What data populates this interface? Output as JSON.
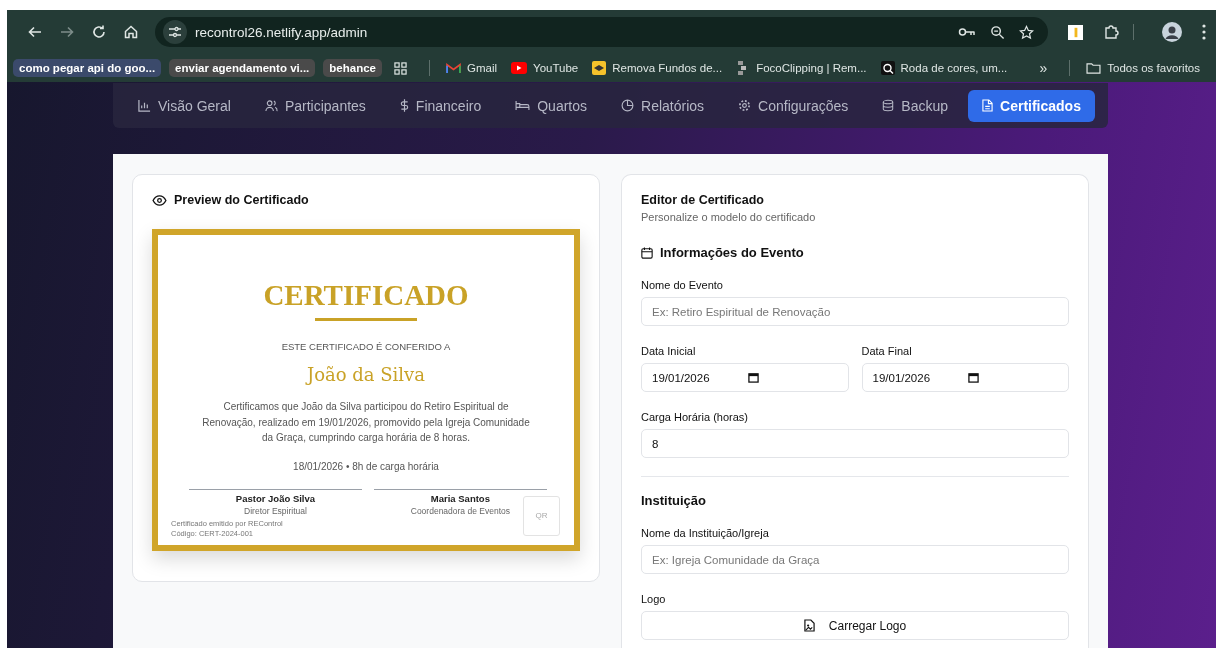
{
  "browser": {
    "nav_buttons": [
      {
        "kind": "back",
        "disabled": false
      },
      {
        "kind": "forward",
        "disabled": true
      },
      {
        "kind": "reload",
        "disabled": false
      },
      {
        "kind": "home",
        "disabled": false
      }
    ],
    "url": "recontrol26.netlify.app/admin",
    "bookmarks": [
      {
        "label": "como pegar api do goo...",
        "kind": "chip",
        "color": "#3b4a6b"
      },
      {
        "label": "enviar agendamento vi...",
        "kind": "chip",
        "color": "#4a4a4a"
      },
      {
        "label": "behance",
        "kind": "chip",
        "color": "#4a4a4a"
      },
      {
        "label": "Gmail",
        "kind": "gmail"
      },
      {
        "label": "YouTube",
        "kind": "youtube"
      },
      {
        "label": "Remova Fundos de...",
        "kind": "remova"
      },
      {
        "label": "FocoClipping | Rem...",
        "kind": "foco"
      },
      {
        "label": "Roda de cores, um...",
        "kind": "roda"
      }
    ],
    "more": "»",
    "all_bookmarks": "Todos os favoritos"
  },
  "tabs": [
    {
      "label": "Visão Geral",
      "kind": "chart",
      "selected": false
    },
    {
      "label": "Participantes",
      "kind": "users",
      "selected": false
    },
    {
      "label": "Financeiro",
      "kind": "dollar",
      "selected": false
    },
    {
      "label": "Quartos",
      "kind": "bed",
      "selected": false
    },
    {
      "label": "Relatórios",
      "kind": "pie",
      "selected": false
    },
    {
      "label": "Configurações",
      "kind": "gear",
      "selected": false
    },
    {
      "label": "Backup",
      "kind": "database",
      "selected": false
    },
    {
      "label": "Certificados",
      "kind": "file",
      "selected": true
    }
  ],
  "preview": {
    "title": "Preview do Certificado",
    "certificate": {
      "heading": "CERTIFICADO",
      "conferred": "ESTE CERTIFICADO É CONFERIDO A",
      "name": "João da Silva",
      "body": "Certificamos que João da Silva participou do Retiro Espiritual de Renovação, realizado em 19/01/2026, promovido pela Igreja Comunidade da Graça, cumprindo carga horária de 8 horas.",
      "meta": "18/01/2026 • 8h de carga horária",
      "signatures": [
        {
          "name": "Pastor João Silva",
          "role": "Diretor Espiritual"
        },
        {
          "name": "Maria Santos",
          "role": "Coordenadora de Eventos"
        }
      ],
      "footer": [
        "Certificado emitido por REControl",
        "Código: CERT-2024-001"
      ],
      "qr": "QR"
    }
  },
  "editor": {
    "title": "Editor de Certificado",
    "subtitle": "Personalize o modelo do certificado",
    "event_section": {
      "title": "Informações do Evento",
      "event_name": {
        "label": "Nome do Evento",
        "placeholder": "Ex: Retiro Espiritual de Renovação"
      },
      "dates": [
        {
          "label": "Data Inicial",
          "value": "19/01/2026"
        },
        {
          "label": "Data Final",
          "value": "19/01/2026"
        }
      ],
      "hours": {
        "label": "Carga Horária (horas)",
        "value": "8"
      }
    },
    "institution_section": {
      "title": "Instituição",
      "institution_name": {
        "label": "Nome da Instituição/Igreja",
        "placeholder": "Ex: Igreja Comunidade da Graça"
      },
      "logo": {
        "label": "Logo",
        "button": "Carregar Logo"
      }
    }
  }
}
